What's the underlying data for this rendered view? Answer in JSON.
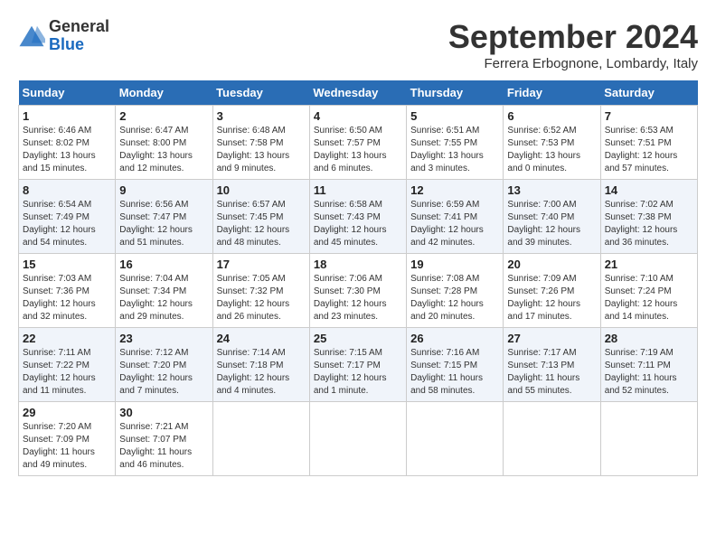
{
  "logo": {
    "general": "General",
    "blue": "Blue"
  },
  "title": "September 2024",
  "location": "Ferrera Erbognone, Lombardy, Italy",
  "headers": [
    "Sunday",
    "Monday",
    "Tuesday",
    "Wednesday",
    "Thursday",
    "Friday",
    "Saturday"
  ],
  "weeks": [
    [
      {
        "day": "1",
        "info": "Sunrise: 6:46 AM\nSunset: 8:02 PM\nDaylight: 13 hours and 15 minutes."
      },
      {
        "day": "2",
        "info": "Sunrise: 6:47 AM\nSunset: 8:00 PM\nDaylight: 13 hours and 12 minutes."
      },
      {
        "day": "3",
        "info": "Sunrise: 6:48 AM\nSunset: 7:58 PM\nDaylight: 13 hours and 9 minutes."
      },
      {
        "day": "4",
        "info": "Sunrise: 6:50 AM\nSunset: 7:57 PM\nDaylight: 13 hours and 6 minutes."
      },
      {
        "day": "5",
        "info": "Sunrise: 6:51 AM\nSunset: 7:55 PM\nDaylight: 13 hours and 3 minutes."
      },
      {
        "day": "6",
        "info": "Sunrise: 6:52 AM\nSunset: 7:53 PM\nDaylight: 13 hours and 0 minutes."
      },
      {
        "day": "7",
        "info": "Sunrise: 6:53 AM\nSunset: 7:51 PM\nDaylight: 12 hours and 57 minutes."
      }
    ],
    [
      {
        "day": "8",
        "info": "Sunrise: 6:54 AM\nSunset: 7:49 PM\nDaylight: 12 hours and 54 minutes."
      },
      {
        "day": "9",
        "info": "Sunrise: 6:56 AM\nSunset: 7:47 PM\nDaylight: 12 hours and 51 minutes."
      },
      {
        "day": "10",
        "info": "Sunrise: 6:57 AM\nSunset: 7:45 PM\nDaylight: 12 hours and 48 minutes."
      },
      {
        "day": "11",
        "info": "Sunrise: 6:58 AM\nSunset: 7:43 PM\nDaylight: 12 hours and 45 minutes."
      },
      {
        "day": "12",
        "info": "Sunrise: 6:59 AM\nSunset: 7:41 PM\nDaylight: 12 hours and 42 minutes."
      },
      {
        "day": "13",
        "info": "Sunrise: 7:00 AM\nSunset: 7:40 PM\nDaylight: 12 hours and 39 minutes."
      },
      {
        "day": "14",
        "info": "Sunrise: 7:02 AM\nSunset: 7:38 PM\nDaylight: 12 hours and 36 minutes."
      }
    ],
    [
      {
        "day": "15",
        "info": "Sunrise: 7:03 AM\nSunset: 7:36 PM\nDaylight: 12 hours and 32 minutes."
      },
      {
        "day": "16",
        "info": "Sunrise: 7:04 AM\nSunset: 7:34 PM\nDaylight: 12 hours and 29 minutes."
      },
      {
        "day": "17",
        "info": "Sunrise: 7:05 AM\nSunset: 7:32 PM\nDaylight: 12 hours and 26 minutes."
      },
      {
        "day": "18",
        "info": "Sunrise: 7:06 AM\nSunset: 7:30 PM\nDaylight: 12 hours and 23 minutes."
      },
      {
        "day": "19",
        "info": "Sunrise: 7:08 AM\nSunset: 7:28 PM\nDaylight: 12 hours and 20 minutes."
      },
      {
        "day": "20",
        "info": "Sunrise: 7:09 AM\nSunset: 7:26 PM\nDaylight: 12 hours and 17 minutes."
      },
      {
        "day": "21",
        "info": "Sunrise: 7:10 AM\nSunset: 7:24 PM\nDaylight: 12 hours and 14 minutes."
      }
    ],
    [
      {
        "day": "22",
        "info": "Sunrise: 7:11 AM\nSunset: 7:22 PM\nDaylight: 12 hours and 11 minutes."
      },
      {
        "day": "23",
        "info": "Sunrise: 7:12 AM\nSunset: 7:20 PM\nDaylight: 12 hours and 7 minutes."
      },
      {
        "day": "24",
        "info": "Sunrise: 7:14 AM\nSunset: 7:18 PM\nDaylight: 12 hours and 4 minutes."
      },
      {
        "day": "25",
        "info": "Sunrise: 7:15 AM\nSunset: 7:17 PM\nDaylight: 12 hours and 1 minute."
      },
      {
        "day": "26",
        "info": "Sunrise: 7:16 AM\nSunset: 7:15 PM\nDaylight: 11 hours and 58 minutes."
      },
      {
        "day": "27",
        "info": "Sunrise: 7:17 AM\nSunset: 7:13 PM\nDaylight: 11 hours and 55 minutes."
      },
      {
        "day": "28",
        "info": "Sunrise: 7:19 AM\nSunset: 7:11 PM\nDaylight: 11 hours and 52 minutes."
      }
    ],
    [
      {
        "day": "29",
        "info": "Sunrise: 7:20 AM\nSunset: 7:09 PM\nDaylight: 11 hours and 49 minutes."
      },
      {
        "day": "30",
        "info": "Sunrise: 7:21 AM\nSunset: 7:07 PM\nDaylight: 11 hours and 46 minutes."
      },
      {
        "day": "",
        "info": ""
      },
      {
        "day": "",
        "info": ""
      },
      {
        "day": "",
        "info": ""
      },
      {
        "day": "",
        "info": ""
      },
      {
        "day": "",
        "info": ""
      }
    ]
  ]
}
